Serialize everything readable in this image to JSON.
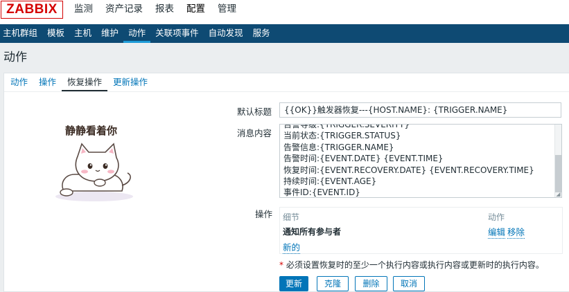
{
  "logo": "ZABBIX",
  "main_menu": [
    {
      "label": "监测",
      "active": false
    },
    {
      "label": "资产记录",
      "active": false
    },
    {
      "label": "报表",
      "active": false
    },
    {
      "label": "配置",
      "active": true
    },
    {
      "label": "管理",
      "active": false
    }
  ],
  "sub_menu": [
    {
      "label": "主机群组",
      "active": false
    },
    {
      "label": "模板",
      "active": false
    },
    {
      "label": "主机",
      "active": false
    },
    {
      "label": "维护",
      "active": false
    },
    {
      "label": "动作",
      "active": true
    },
    {
      "label": "关联项事件",
      "active": false
    },
    {
      "label": "自动发现",
      "active": false
    },
    {
      "label": "服务",
      "active": false
    }
  ],
  "page_title": "动作",
  "tabs": [
    {
      "label": "动作",
      "active": false
    },
    {
      "label": "操作",
      "active": false
    },
    {
      "label": "恢复操作",
      "active": true
    },
    {
      "label": "更新操作",
      "active": false
    }
  ],
  "avatar_caption": "静静看着你",
  "form": {
    "subject_label": "默认标题",
    "subject_value": "{{OK}}触发器恢复---{HOST.NAME}: {TRIGGER.NAME}",
    "message_label": "消息内容",
    "message_lines": [
      "告警等级:{TRIGGER.SEVERITY}",
      "当前状态:{TRIGGER.STATUS}",
      "告警信息:{TRIGGER.NAME}",
      "告警时间:{EVENT.DATE} {EVENT.TIME}",
      "恢复时间:{EVENT.RECOVERY.DATE} {EVENT.RECOVERY.TIME}",
      "持续时间:{EVENT.AGE}",
      "事件ID:{EVENT.ID}"
    ],
    "operations_label": "操作",
    "operations": {
      "col_detail": "细节",
      "col_action": "动作",
      "row_detail": "通知所有参与者",
      "edit": "编辑",
      "remove": "移除",
      "new": "新的"
    },
    "note_star": "*",
    "note_text": "必须设置恢复时的至少一个执行内容或执行内容或更新时的执行内容。"
  },
  "buttons": {
    "update": "更新",
    "clone": "克隆",
    "delete": "删除",
    "cancel": "取消"
  },
  "colors": {
    "nav_bg": "#0e4a73",
    "accent": "#0275b8",
    "logo": "#d40000"
  }
}
